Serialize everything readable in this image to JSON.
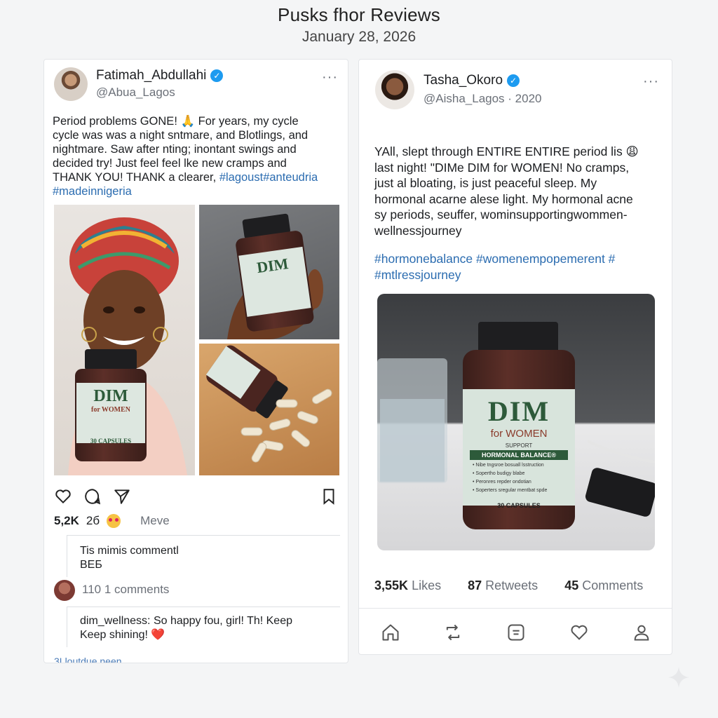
{
  "page": {
    "title": "Pusks fhor Reviews",
    "date": "January 28, 2026"
  },
  "left_post": {
    "display_name": "Fatimah_Abdullahi",
    "handle": "@Abua_Lagos",
    "body_lines": [
      "Period problems GONE! 🙏 For years, my cycle",
      "cycle was was a night sntmare, and Blotlings, and",
      "nightmare. Saw after nting; inontant swings and",
      "decided try! Just feel feel lke new cramps and"
    ],
    "body_last_plain": "THANK YOU! THANK a clearer,",
    "body_last_tag": "#lagoust#anteudria",
    "hashtag_line": "#madeinnigeria",
    "likes": "5,2K",
    "likes_extra": "2б",
    "more_label": "Meve",
    "comment_line1": "Tis mimis commentl",
    "comment_line2": "ВЕБ",
    "comments_count": "110 1 comments",
    "reply_user": "dim_wellness:",
    "reply_text_1": "So happy fou, girl! Th! Keep",
    "reply_text_2": "Keep shining!",
    "reply_heart": "❤️",
    "footer_cut": "3Lloutdue neen",
    "icons": [
      "heart-icon",
      "comment-icon",
      "share-icon",
      "bookmark-icon"
    ]
  },
  "right_post": {
    "display_name": "Tasha_Okoro",
    "handle": "@Aisha_Lagos",
    "year": "· 2020",
    "body_lines": [
      "YAll, slept through ENTIRE ENTIRE period lis 😩",
      "last night! \"DIMe DIM for WOMEN! No cramps,",
      "just al bloating, is just peaceful sleep. My",
      "hormonal acarne alese light. My hormonal acne",
      "sy periods, seuffer, wominsupportingwommen-",
      "wellnessjourney"
    ],
    "hashtags_1": "#hormonebalance #womenempopemerent #",
    "hashtags_2": "#mtlressjourney",
    "likes_num": "3,55K",
    "likes_label": "Likes",
    "retweets_num": "87",
    "retweets_label": "Retweets",
    "comments_num": "45",
    "comments_label": "Comments",
    "nav_icons": [
      "home-icon",
      "retweet-icon",
      "message-icon",
      "heart-icon",
      "profile-icon"
    ]
  },
  "product": {
    "brand": "DIM",
    "subtitle": "for WOMEN",
    "support": "SUPPORT",
    "balance": "HORMONAL BALANCE®",
    "bullets": [
      "• Nibe tngsroe bosuall lsstruction",
      "• Sopertho budigy blabe",
      "• Peronres repder ondotian",
      "• Soperters sregular mentbat spde"
    ],
    "capsules": "30 CAPSULES",
    "small_label_subtitle": "for WOMEN",
    "small_capsules": "30 CAPSULES"
  },
  "colors": {
    "accent_blue": "#1d9bf0",
    "hashtag_blue": "#2b6cb0",
    "heart_red": "#e0245e",
    "label_green": "#2d5a3a",
    "bottle_brown": "#4a2520"
  }
}
